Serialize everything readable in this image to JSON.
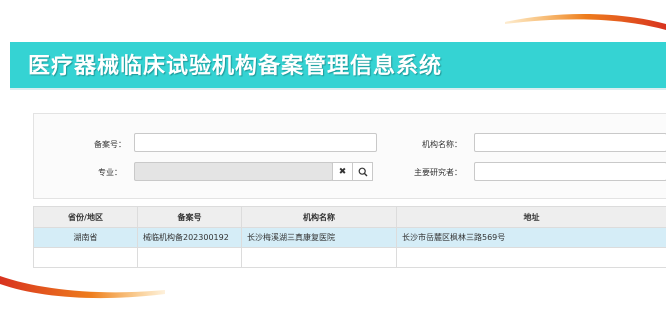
{
  "header": {
    "title": "医疗器械临床试验机构备案管理信息系统"
  },
  "search": {
    "record_no_label": "备案号：",
    "record_no_value": "",
    "institution_name_label": "机构名称：",
    "institution_name_value": "",
    "specialty_label": "专业：",
    "specialty_value": "",
    "investigator_label": "主要研究者：",
    "investigator_value": "",
    "clear_glyph": "✖",
    "search_glyph": "⚲"
  },
  "table": {
    "columns": [
      "省份/地区",
      "备案号",
      "机构名称",
      "地址"
    ],
    "rows": [
      {
        "province": "湖南省",
        "record_no": "械临机构备202300192",
        "name": "长沙梅溪湖三真康复医院",
        "address": "长沙市岳麓区枫林三路569号"
      }
    ]
  },
  "colors": {
    "banner": "#35d3d3",
    "selected_row": "#d5edf7",
    "swoosh": "#e8521f"
  },
  "icons": [
    "clear-icon",
    "search-icon"
  ]
}
